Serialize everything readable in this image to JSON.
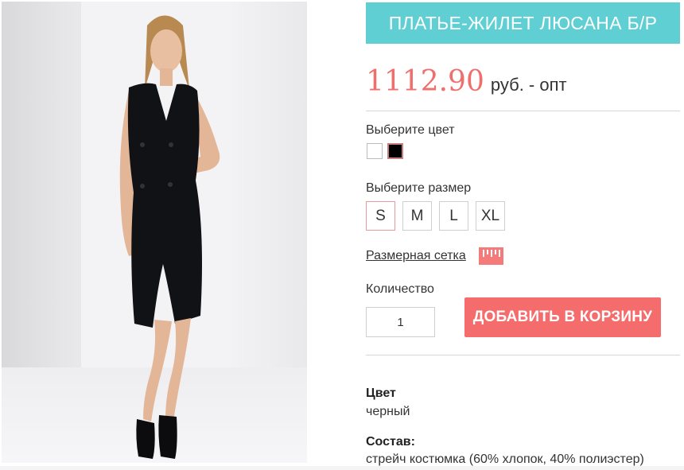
{
  "product": {
    "title": "ПЛАТЬЕ-ЖИЛЕТ ЛЮСАНА Б/Р",
    "price": "1112.90",
    "price_unit": "руб. - опт"
  },
  "color_picker": {
    "label": "Выберите цвет",
    "swatches": [
      {
        "name": "white",
        "hex": "#ffffff"
      },
      {
        "name": "black",
        "hex": "#000000",
        "selected": true
      }
    ]
  },
  "size_picker": {
    "label": "Выберите размер",
    "sizes": [
      "S",
      "M",
      "L",
      "XL"
    ],
    "selected": "S"
  },
  "size_chart": {
    "link_label": "Размерная сетка",
    "icon": "ruler-icon"
  },
  "quantity": {
    "label": "Количество",
    "value": "1"
  },
  "cart": {
    "add_label": "ДОБАВИТЬ В КОРЗИНУ"
  },
  "specs": [
    {
      "title": "Цвет",
      "value": "черный"
    },
    {
      "title": "Состав:",
      "value": "стрейч костюмка (60% хлопок, 40% полиэстер)"
    }
  ],
  "colors": {
    "title_bar": "#5fcfd3",
    "price": "#ef6f6c",
    "add_button": "#f46c6c"
  }
}
